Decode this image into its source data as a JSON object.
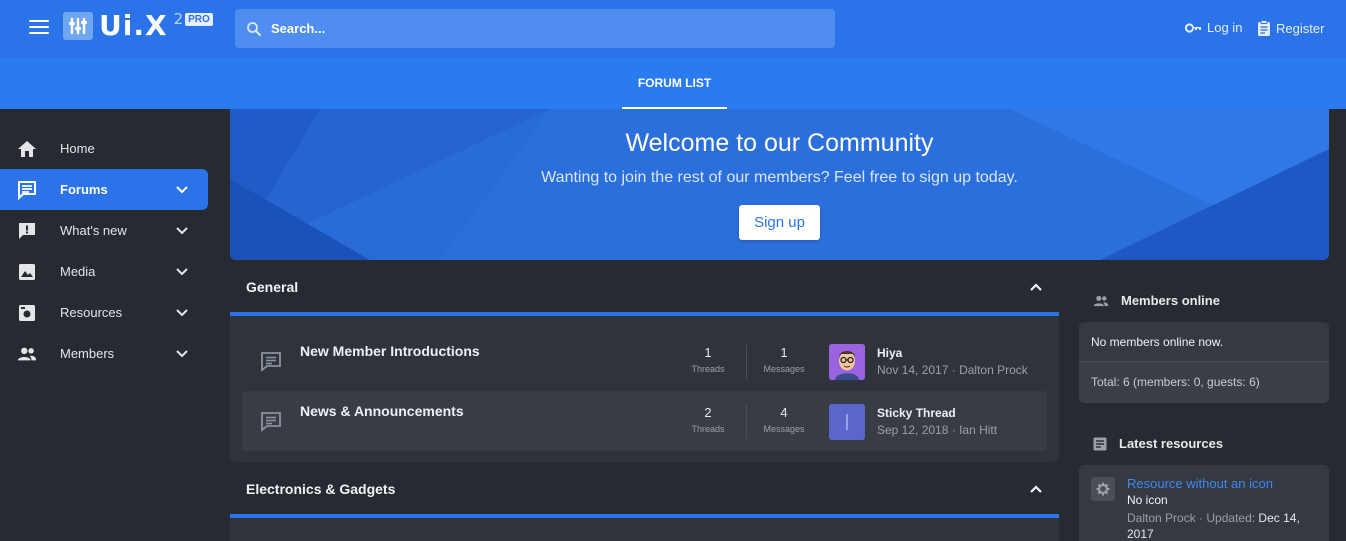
{
  "header": {
    "logo_text": "Ui.X",
    "logo_sup": "2",
    "logo_badge": "PRO",
    "search_placeholder": "Search...",
    "login_label": "Log in",
    "register_label": "Register"
  },
  "subnav": {
    "active_tab": "FORUM LIST"
  },
  "sidebar": {
    "items": [
      {
        "label": "Home",
        "icon": "home-icon",
        "active": false,
        "has_chevron": false
      },
      {
        "label": "Forums",
        "icon": "forums-icon",
        "active": true,
        "has_chevron": true
      },
      {
        "label": "What's new",
        "icon": "whats-new-icon",
        "active": false,
        "has_chevron": true
      },
      {
        "label": "Media",
        "icon": "media-icon",
        "active": false,
        "has_chevron": true
      },
      {
        "label": "Resources",
        "icon": "resources-icon",
        "active": false,
        "has_chevron": true
      },
      {
        "label": "Members",
        "icon": "members-icon",
        "active": false,
        "has_chevron": true
      }
    ]
  },
  "banner": {
    "title": "Welcome to our Community",
    "subtitle": "Wanting to join the rest of our members? Feel free to sign up today.",
    "button_label": "Sign up"
  },
  "categories": [
    {
      "title": "General",
      "nodes": [
        {
          "title": "New Member Introductions",
          "threads": "1",
          "threads_label": "Threads",
          "messages": "1",
          "messages_label": "Messages",
          "last_title": "Hiya",
          "last_date": "Nov 14, 2017",
          "last_user": "Dalton Prock"
        },
        {
          "title": "News & Announcements",
          "threads": "2",
          "threads_label": "Threads",
          "messages": "4",
          "messages_label": "Messages",
          "last_title": "Sticky Thread",
          "last_date": "Sep 12, 2018",
          "last_user": "Ian Hitt"
        }
      ]
    },
    {
      "title": "Electronics & Gadgets",
      "nodes": []
    }
  ],
  "widgets": {
    "members_online": {
      "title": "Members online",
      "status": "No members online now.",
      "total": "Total: 6 (members: 0, guests: 6)"
    },
    "latest_resources": {
      "title": "Latest resources",
      "item_title": "Resource without an icon",
      "item_subtitle": "No icon",
      "item_author": "Dalton Prock",
      "item_updated_label": "Updated:",
      "item_updated_date": "Dec 14, 2017"
    }
  },
  "colors": {
    "accent": "#2a73e8",
    "background": "#272a31",
    "panel": "#2f333b"
  }
}
